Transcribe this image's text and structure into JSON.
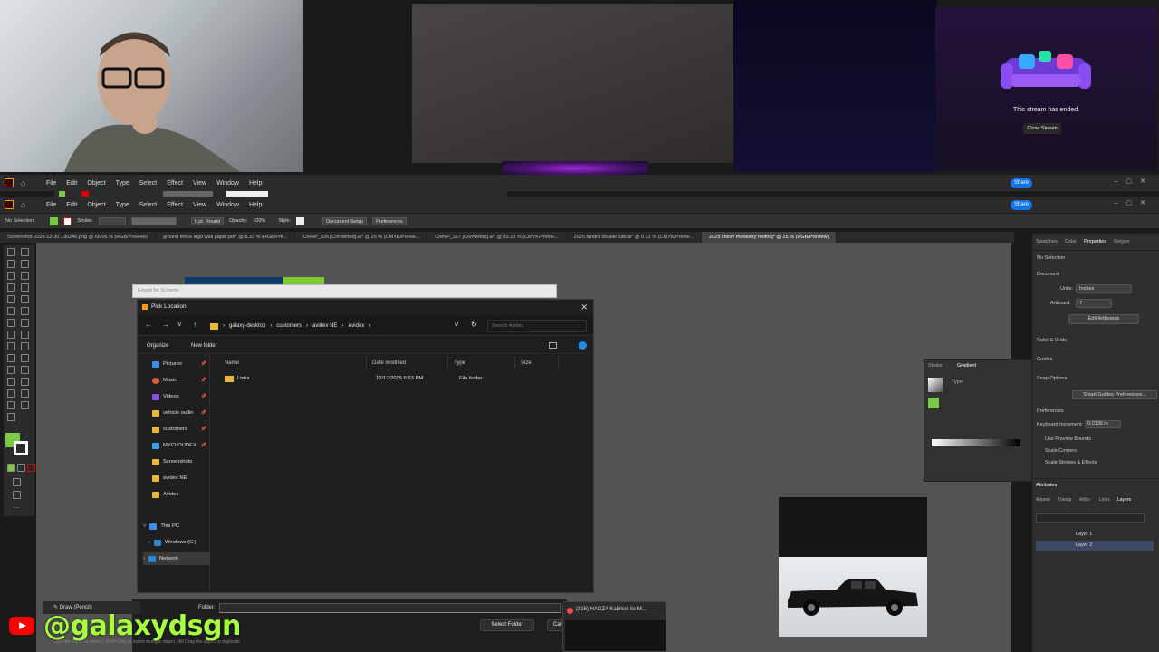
{
  "stream": {
    "ended_text": "This stream has ended.",
    "close_button": "Close Stream"
  },
  "menubar": {
    "items": [
      "File",
      "Edit",
      "Object",
      "Type",
      "Select",
      "Effect",
      "View",
      "Window",
      "Help"
    ],
    "share": "Share"
  },
  "controlbar": {
    "selection": "No Selection",
    "stroke_label": "Stroke:",
    "brush": "5 pt. Round",
    "opacity_label": "Opacity:",
    "opacity": "100%",
    "style_label": "Style:",
    "doc_setup": "Document Setup",
    "preferences": "Preferences"
  },
  "doc_tabs": [
    "Screenshot 2025-12-30 130246.png @ 66.06 % (RGB/Preview)",
    "ground fence logo wall paper.pdf* @ 8.33 % (RGB/Pre...",
    "ChevP_326 [Converted].ai* @ 25 % (CMYK/Previe...",
    "ChevP_327 [Converted].ai* @ 33.33 % (CMYK/Previe...",
    "2025 tundra double cab.ai* @ 0.31 % (CMYK/Previe...",
    "2025 chevy monestry roofing* @ 25 % (RGB/Preview)"
  ],
  "properties_panel": {
    "tabs": [
      "Swatches",
      "Color",
      "Properties",
      "Retype"
    ],
    "no_selection": "No Selection",
    "document": "Document",
    "units_label": "Units:",
    "units_value": "Inches",
    "artboard_label": "Artboard:",
    "artboard_value": "7",
    "edit_artboards": "Edit Artboards",
    "ruler_grids": "Ruler & Grids",
    "guides": "Guides",
    "snap_options": "Snap Options",
    "smart_guides": "Smart Guides Preferences...",
    "preferences": "Preferences",
    "keyboard_increment": "Keyboard Increment:",
    "increment_value": "0.0139 in",
    "use_preview_bounds": "Use Preview Bounds",
    "scale_corners": "Scale Corners",
    "scale_strokes": "Scale Strokes & Effects"
  },
  "gradient_panel": {
    "tabs": [
      "Stroke",
      "Gradient"
    ],
    "type_label": "Type:"
  },
  "layers_panel": {
    "header": "Attributes",
    "tabs": [
      "Appear",
      "Transp",
      "Artbo",
      "Links",
      "Layers"
    ],
    "layers": [
      "Layer 1",
      "Layer 2"
    ]
  },
  "export_window": {
    "title": "Export for Screens"
  },
  "dialog": {
    "title": "Pick Location",
    "breadcrumb": [
      "galaxy-desktop",
      "customers",
      "avidex NE",
      "Avidex"
    ],
    "search_placeholder": "Search Avidex",
    "organize": "Organize",
    "new_folder": "New folder",
    "nav_items": [
      {
        "label": "Pictures",
        "pinned": true
      },
      {
        "label": "Music",
        "pinned": true
      },
      {
        "label": "Videos",
        "pinned": true
      },
      {
        "label": "vehicle outlin",
        "pinned": true
      },
      {
        "label": "customers",
        "pinned": true
      },
      {
        "label": "MYCLOUDEX",
        "pinned": true
      },
      {
        "label": "Screenshots",
        "pinned": false
      },
      {
        "label": "avidex NE",
        "pinned": false
      },
      {
        "label": "Avidex",
        "pinned": false
      }
    ],
    "this_pc": "This PC",
    "windows_drive": "Windows (C:)",
    "network": "Network",
    "columns": [
      "Name",
      "Date modified",
      "Type",
      "Size"
    ],
    "files": [
      {
        "name": "Links",
        "date": "12/17/2025 6:53 PM",
        "type": "File folder",
        "size": ""
      }
    ],
    "folder_label": "Folder:",
    "folder_value": "",
    "select_folder": "Select Folder",
    "cancel": "Cancel"
  },
  "tooling": {
    "draw_mode": "Draw (Pencil)",
    "status_hint": "Click the object to select | Shift+Click to select multiple object | Alt Drag the object to duplicate"
  },
  "browser_popup": {
    "title": "(216) HADZA Kabilesi ile M..."
  },
  "overlay": {
    "handle": "@galaxydsgn"
  },
  "colors": {
    "accent": "#1473e6",
    "fill_swatch": "#7ac943",
    "handle_green": "#a8ff3e",
    "folder_yellow": "#e8b73a"
  }
}
